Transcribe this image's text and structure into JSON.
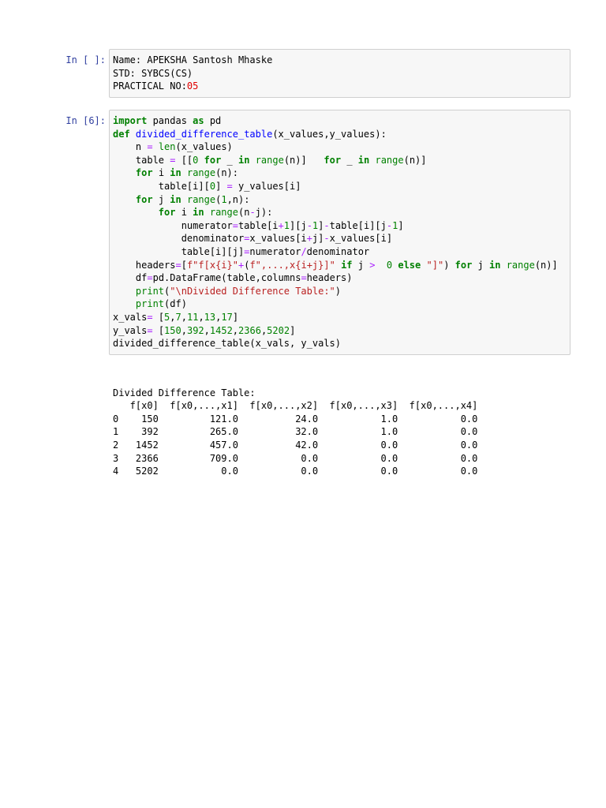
{
  "cells": [
    {
      "prompt": "In [ ]:",
      "lines": [
        [
          [
            "Name: APEKSHA Santosh Mhaske",
            ""
          ]
        ],
        [
          [
            "STD: SYBCS(CS)",
            ""
          ]
        ],
        [
          [
            "PRACTICAL NO:",
            ""
          ],
          [
            "05",
            "red"
          ]
        ]
      ]
    },
    {
      "prompt": "In [6]:",
      "lines": [
        [
          [
            "import",
            "k"
          ],
          [
            " pandas ",
            ""
          ],
          [
            "as",
            "k"
          ],
          [
            " pd",
            ""
          ]
        ],
        [
          [
            "def",
            "k"
          ],
          [
            " ",
            ""
          ],
          [
            "divided_difference_table",
            "f"
          ],
          [
            "(x_values,y_values):",
            ""
          ]
        ],
        [
          [
            "    n ",
            ""
          ],
          [
            "=",
            "o"
          ],
          [
            " ",
            ""
          ],
          [
            "len",
            "b"
          ],
          [
            "(x_values)",
            ""
          ]
        ],
        [
          [
            "    table ",
            ""
          ],
          [
            "=",
            "o"
          ],
          [
            " [[",
            ""
          ],
          [
            "0",
            "n"
          ],
          [
            " ",
            ""
          ],
          [
            "for",
            "k"
          ],
          [
            " _ ",
            ""
          ],
          [
            "in",
            "k"
          ],
          [
            " ",
            ""
          ],
          [
            "range",
            "b"
          ],
          [
            "(n)]   ",
            ""
          ],
          [
            "for",
            "k"
          ],
          [
            " _ ",
            ""
          ],
          [
            "in",
            "k"
          ],
          [
            " ",
            ""
          ],
          [
            "range",
            "b"
          ],
          [
            "(n)]",
            ""
          ]
        ],
        [
          [
            "    ",
            ""
          ],
          [
            "for",
            "k"
          ],
          [
            " i ",
            ""
          ],
          [
            "in",
            "k"
          ],
          [
            " ",
            ""
          ],
          [
            "range",
            "b"
          ],
          [
            "(n):",
            ""
          ]
        ],
        [
          [
            "        table[i][",
            ""
          ],
          [
            "0",
            "n"
          ],
          [
            "] ",
            ""
          ],
          [
            "=",
            "o"
          ],
          [
            " y_values[i]",
            ""
          ]
        ],
        [
          [
            "    ",
            ""
          ],
          [
            "for",
            "k"
          ],
          [
            " j ",
            ""
          ],
          [
            "in",
            "k"
          ],
          [
            " ",
            ""
          ],
          [
            "range",
            "b"
          ],
          [
            "(",
            ""
          ],
          [
            "1",
            "n"
          ],
          [
            ",n):",
            ""
          ]
        ],
        [
          [
            "        ",
            ""
          ],
          [
            "for",
            "k"
          ],
          [
            " i ",
            ""
          ],
          [
            "in",
            "k"
          ],
          [
            " ",
            ""
          ],
          [
            "range",
            "b"
          ],
          [
            "(n",
            ""
          ],
          [
            "-",
            "o"
          ],
          [
            "j):",
            ""
          ]
        ],
        [
          [
            "            numerator",
            ""
          ],
          [
            "=",
            "o"
          ],
          [
            "table[i",
            ""
          ],
          [
            "+",
            "o"
          ],
          [
            "1",
            "n"
          ],
          [
            "][j",
            ""
          ],
          [
            "-",
            "o"
          ],
          [
            "1",
            "n"
          ],
          [
            "]",
            ""
          ],
          [
            "-",
            "o"
          ],
          [
            "table[i][j",
            ""
          ],
          [
            "-",
            "o"
          ],
          [
            "1",
            "n"
          ],
          [
            "]",
            ""
          ]
        ],
        [
          [
            "            denominator",
            ""
          ],
          [
            "=",
            "o"
          ],
          [
            "x_values[i",
            ""
          ],
          [
            "+",
            "o"
          ],
          [
            "j]",
            ""
          ],
          [
            "-",
            "o"
          ],
          [
            "x_values[i]",
            ""
          ]
        ],
        [
          [
            "            table[i][j]",
            ""
          ],
          [
            "=",
            "o"
          ],
          [
            "numerator",
            ""
          ],
          [
            "/",
            "o"
          ],
          [
            "denominator",
            ""
          ]
        ],
        [
          [
            "    headers",
            ""
          ],
          [
            "=",
            "o"
          ],
          [
            "[",
            ""
          ],
          [
            "f\"f[x{i}\"",
            "s"
          ],
          [
            "+",
            "o"
          ],
          [
            "(",
            ""
          ],
          [
            "f\",...,x{i+j}]\"",
            "s"
          ],
          [
            " ",
            ""
          ],
          [
            "if",
            "k"
          ],
          [
            " j ",
            ""
          ],
          [
            ">",
            "o"
          ],
          [
            "  ",
            ""
          ],
          [
            "0",
            "n"
          ],
          [
            " ",
            ""
          ],
          [
            "else",
            "k"
          ],
          [
            " ",
            ""
          ],
          [
            "\"]\"",
            "s"
          ],
          [
            ") ",
            ""
          ],
          [
            "for",
            "k"
          ],
          [
            " j ",
            ""
          ],
          [
            "in",
            "k"
          ],
          [
            " ",
            ""
          ],
          [
            "range",
            "b"
          ],
          [
            "(n)]",
            ""
          ]
        ],
        [
          [
            "    df",
            ""
          ],
          [
            "=",
            "o"
          ],
          [
            "pd.DataFrame(table,columns",
            ""
          ],
          [
            "=",
            "o"
          ],
          [
            "headers)",
            ""
          ]
        ],
        [
          [
            "    ",
            ""
          ],
          [
            "print",
            "b"
          ],
          [
            "(",
            ""
          ],
          [
            "\"\\nDivided Difference Table:\"",
            "s"
          ],
          [
            ")",
            ""
          ]
        ],
        [
          [
            "    ",
            ""
          ],
          [
            "print",
            "b"
          ],
          [
            "(df)",
            ""
          ]
        ],
        [
          [
            "x_vals",
            ""
          ],
          [
            "=",
            "o"
          ],
          [
            " [",
            ""
          ],
          [
            "5",
            "n"
          ],
          [
            ",",
            ""
          ],
          [
            "7",
            "n"
          ],
          [
            ",",
            ""
          ],
          [
            "11",
            "n"
          ],
          [
            ",",
            ""
          ],
          [
            "13",
            "n"
          ],
          [
            ",",
            ""
          ],
          [
            "17",
            "n"
          ],
          [
            "]",
            ""
          ]
        ],
        [
          [
            "y_vals",
            ""
          ],
          [
            "=",
            "o"
          ],
          [
            " [",
            ""
          ],
          [
            "150",
            "n"
          ],
          [
            ",",
            ""
          ],
          [
            "392",
            "n"
          ],
          [
            ",",
            ""
          ],
          [
            "1452",
            "n"
          ],
          [
            ",",
            ""
          ],
          [
            "2366",
            "n"
          ],
          [
            ",",
            ""
          ],
          [
            "5202",
            "n"
          ],
          [
            "]",
            ""
          ]
        ],
        [
          [
            "divided_difference_table(x_vals, y_vals)",
            ""
          ]
        ]
      ]
    }
  ],
  "output": [
    "",
    "Divided Difference Table:",
    "   f[x0]  f[x0,...,x1]  f[x0,...,x2]  f[x0,...,x3]  f[x0,...,x4]",
    "0    150         121.0          24.0           1.0           0.0",
    "1    392         265.0          32.0           1.0           0.0",
    "2   1452         457.0          42.0           0.0           0.0",
    "3   2366         709.0           0.0           0.0           0.0",
    "4   5202           0.0           0.0           0.0           0.0"
  ]
}
